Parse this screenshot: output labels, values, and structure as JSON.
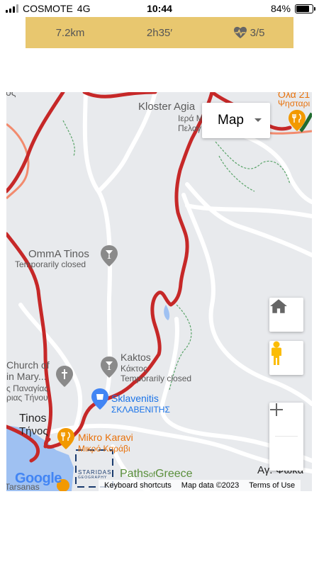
{
  "status_bar": {
    "carrier": "COSMOTE",
    "network": "4G",
    "time": "10:44",
    "battery_percent": "84%",
    "battery_level": 0.84
  },
  "stats": {
    "distance": "7.2km",
    "duration": "2h35′",
    "difficulty": "3/5",
    "difficulty_icon": "heart-pulse-icon"
  },
  "map": {
    "map_type": "Map",
    "keyboard_shortcuts": "Keyboard shortcuts",
    "map_data": "Map data ©2023",
    "terms": "Terms of Use",
    "google_logo": "Google",
    "route_color": "#c62828",
    "labels": {
      "kloster": "Kloster Agia",
      "kloster_gr": "Ιερά Μ",
      "kloster_gr2": "Πελαγ",
      "olla": "Όλα 21",
      "olla_sub": "Ψησταρι",
      "omma": "OmmA Tinos",
      "omma_status": "Temporarily closed",
      "kaktos": "Kaktos",
      "kaktos_gr": "Κάκτος",
      "kaktos_status": "Temporarily closed",
      "church": "Church of",
      "church2": "in Mary...",
      "church_gr": "ς Παναγίας",
      "church_gr2": "ριας Τήνου",
      "sklavenitis": "Sklavenitis",
      "sklavenitis_gr": "ΣΚΛΑΒΕΝΙΤΗΣ",
      "tinos": "Tinos",
      "tinos_gr": "Τήνος",
      "mikro": "Mikro Karavi",
      "mikro_gr": "Μικρό Καράβι",
      "agios": "Αγ. Φωκά",
      "tarsanas": "Tarsanas",
      "top_left": "νος",
      "staridas": "STARIDAS",
      "staridas_sub": "GEOGRAPHY",
      "paths": "Paths",
      "paths_of": "of",
      "paths_greece": "Greece"
    }
  }
}
